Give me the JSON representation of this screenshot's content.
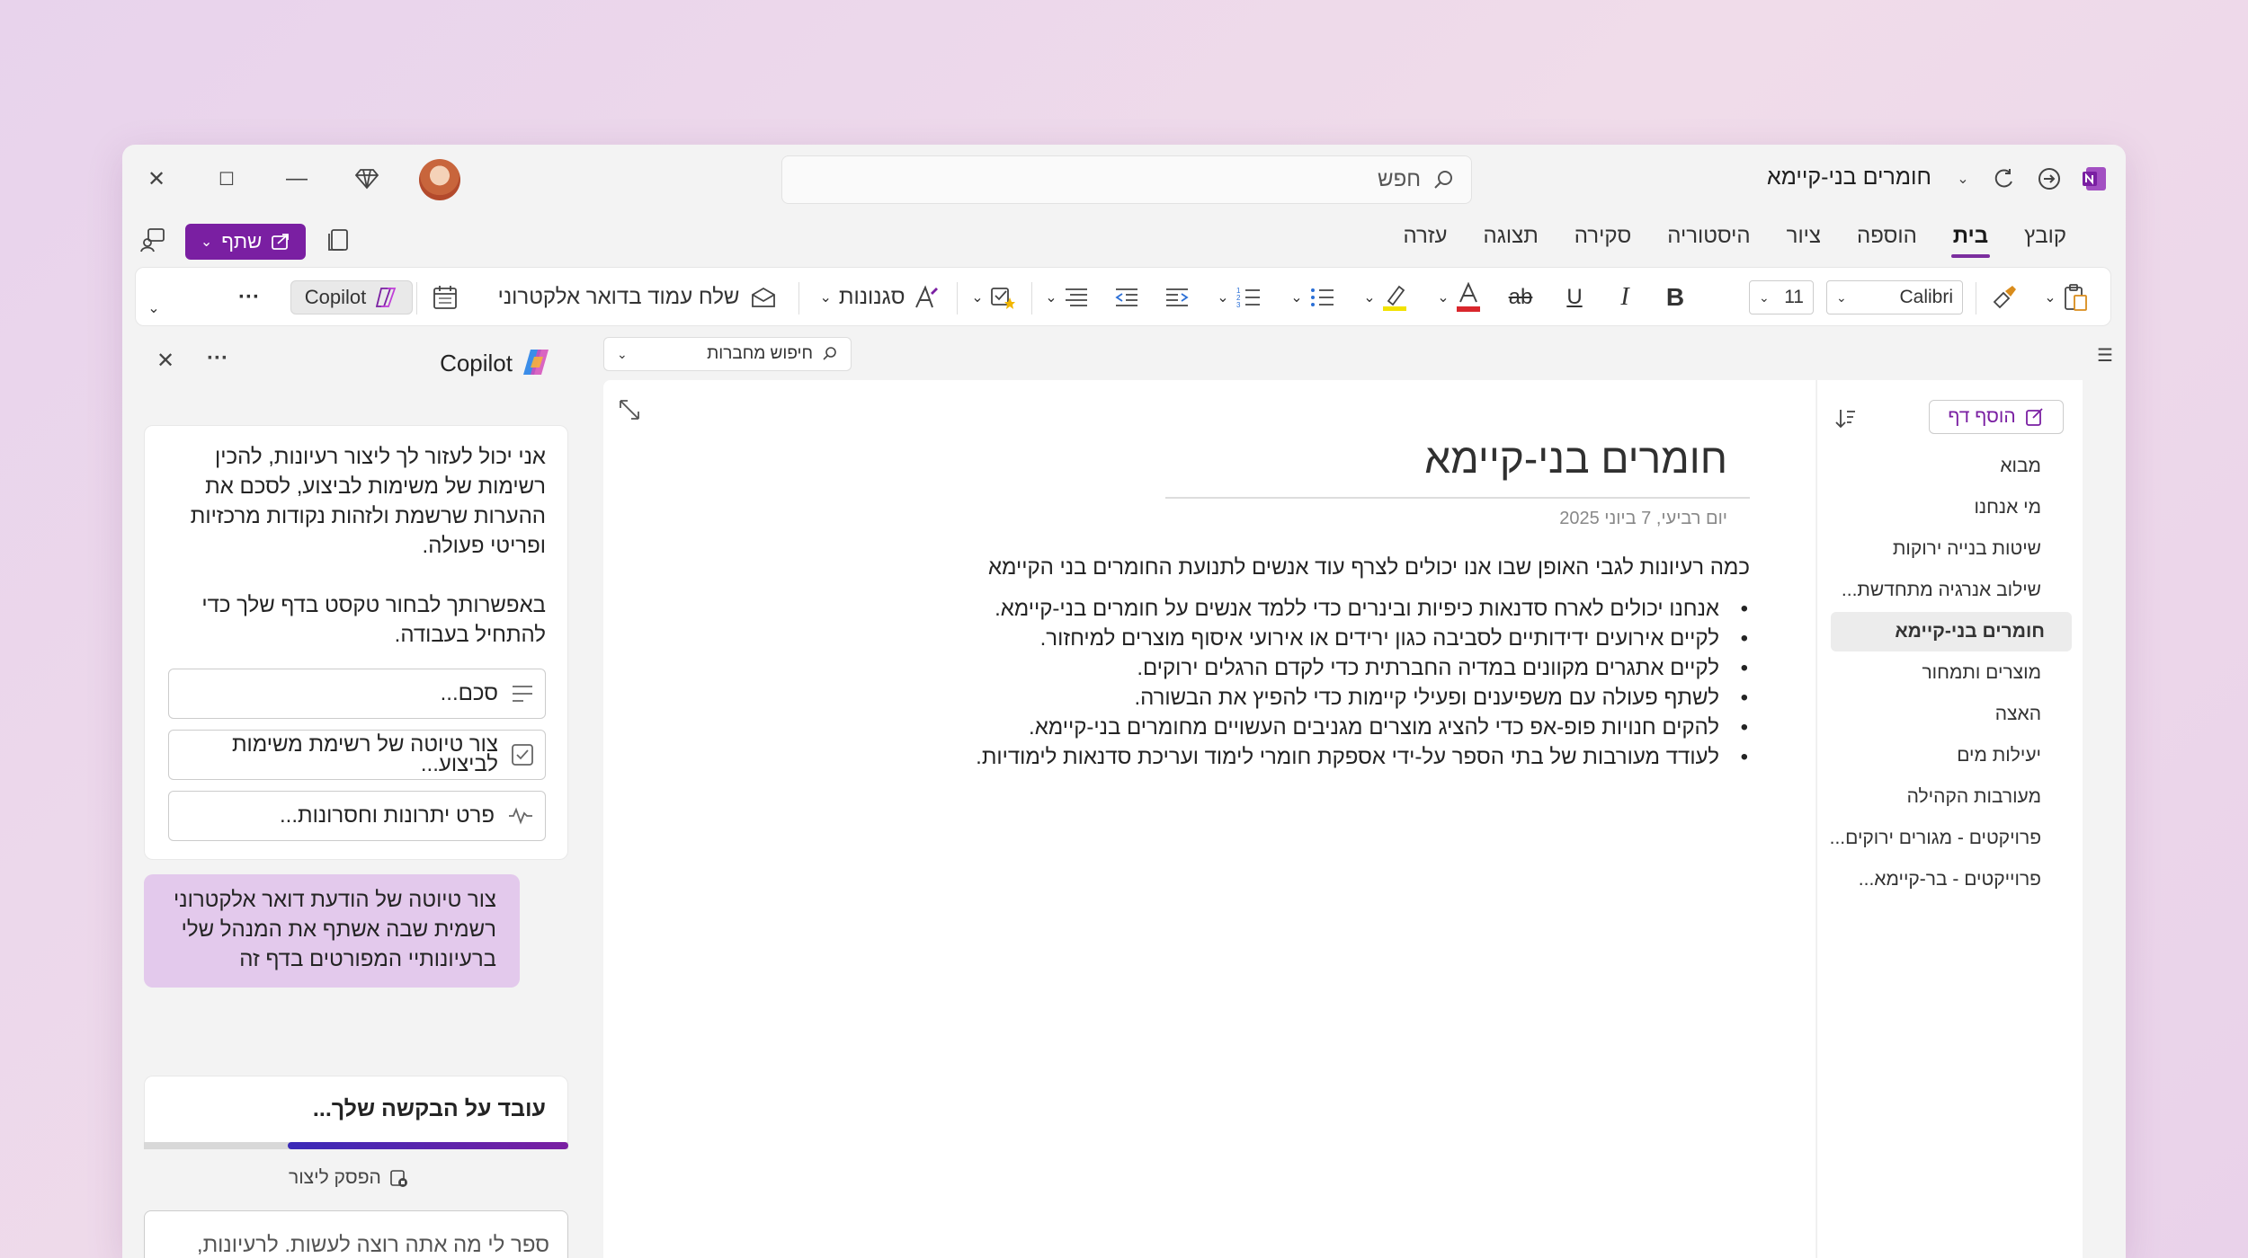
{
  "window": {
    "title": "חומרים בני-קיימא",
    "search_placeholder": "חפש"
  },
  "menu": {
    "items": [
      "קובץ",
      "בית",
      "הוספה",
      "ציור",
      "היסטוריה",
      "סקירה",
      "תצוגה",
      "עזרה"
    ],
    "active": "בית",
    "share_label": "שתף"
  },
  "ribbon": {
    "font_name": "Calibri",
    "font_size": "11",
    "styles_label": "סגנונות",
    "email_label": "שלח עמוד בדואר אלקטרוני",
    "copilot_label": "Copilot",
    "more": "···"
  },
  "copilot": {
    "title": "Copilot",
    "more": "···",
    "intro": "אני יכול לעזור לך ליצור רעיונות, להכין רשימות של משימות לביצוע, לסכם את ההערות שרשמת ולזהות נקודות מרכזיות ופריטי פעולה.",
    "hint": "באפשרותך לבחור טקסט בדף שלך כדי להתחיל בעבודה.",
    "suggestions": [
      "סכם...",
      "צור טיוטה של רשימת משימות לביצוע...",
      "פרט יתרונות וחסרונות..."
    ],
    "user_message": "צור טיוטה של הודעת דואר אלקטרוני רשמית שבה אשתף את המנהל שלי ברעיונותיי המפורטים בדף זה",
    "working": "עובד על הבקשה שלך...",
    "progress": 0.66,
    "stop": "הפסק ליצור",
    "input_placeholder": "ספר לי מה אתה רוצה לעשות. לרעיונות,"
  },
  "notebook_search": "חיפוש מחברות",
  "pages_pane": {
    "add_page": "הוסף דף",
    "items": [
      "מבוא",
      "מי אנחנו",
      "שיטות בנייה ירוקות",
      "שילוב אנרגיה מתחדשת...",
      "חומרים בני-קיימא",
      "מוצרים ותמחור",
      "האצה",
      "יעילות מים",
      "מעורבות הקהילה",
      "פרויקטים - מגורים ירוקים...",
      "פרוייקטים - בר-קיימא..."
    ],
    "selected_index": 4
  },
  "page": {
    "title": "חומרים בני-קיימא",
    "date": "יום רביעי, 7 ביוני 2025",
    "intro": "כמה רעיונות לגבי האופן שבו אנו יכולים לצרף עוד אנשים לתנועת החומרים בני הקיימא",
    "bullets": [
      "אנחנו יכולים לארח סדנאות כיפיות ובינרים כדי ללמד אנשים על חומרים בני-קיימא.",
      "לקיים אירועים ידידותיים לסביבה כגון ירידים או אירועי איסוף מוצרים למיחזור.",
      "לקיים אתגרים מקוונים במדיה החברתית כדי לקדם הרגלים ירוקים.",
      "לשתף פעולה עם משפיענים ופעילי קיימות כדי להפיץ את הבשורה.",
      "להקים חנויות פופ-אפ כדי להציג מוצרים מגניבים העשויים מחומרים בני-קיימא.",
      "לעודד מעורבות של בתי הספר על-ידי אספקת חומרי לימוד ועריכת סדנאות לימודיות."
    ]
  },
  "colors": {
    "accent": "#7a1fa2",
    "background": "#ecd6ec",
    "font_color_red": "#d9262c",
    "highlight_yellow": "#f2e200"
  }
}
